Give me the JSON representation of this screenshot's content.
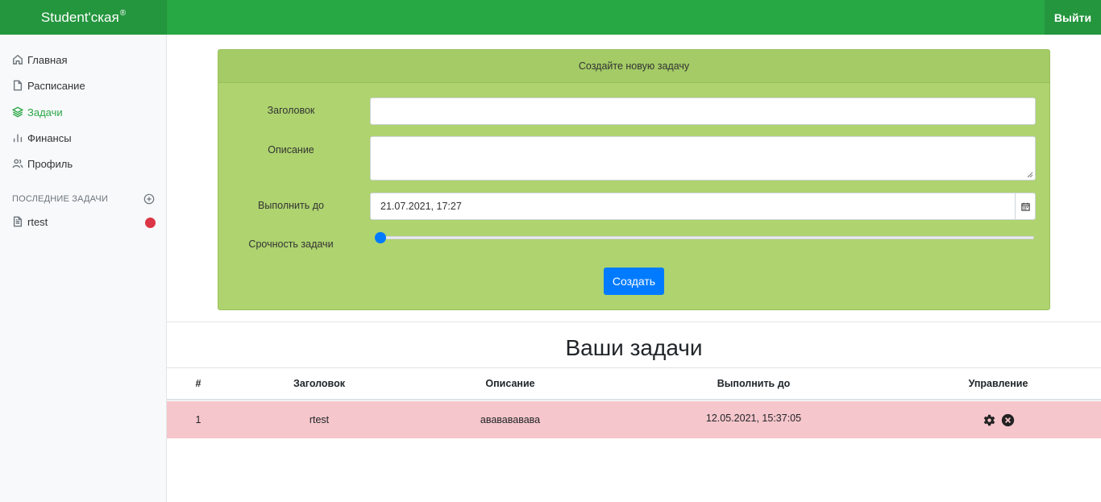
{
  "navbar": {
    "brand": "Student'ская",
    "brand_mark": "®",
    "logout_label": "Выйти",
    "color": "#28a745"
  },
  "sidebar": {
    "items": [
      {
        "label": "Главная",
        "icon": "home-icon",
        "active": false
      },
      {
        "label": "Расписание",
        "icon": "file-icon",
        "active": false
      },
      {
        "label": "Задачи",
        "icon": "layers-icon",
        "active": true
      },
      {
        "label": "Финансы",
        "icon": "bar-chart-icon",
        "active": false
      },
      {
        "label": "Профиль",
        "icon": "users-icon",
        "active": false
      }
    ],
    "recent_heading": "ПОСЛЕДНИЕ ЗАДАЧИ",
    "recent_tasks": [
      {
        "label": "rtest",
        "status_color": "#dc3545"
      }
    ]
  },
  "form": {
    "header": "Создайте новую задачу",
    "title_label": "Заголовок",
    "title_value": "",
    "description_label": "Описание",
    "description_value": "",
    "due_label": "Выполнить до",
    "due_value": "21.07.2021, 17:27",
    "urgency_label": "Срочность задачи",
    "urgency_value": 0,
    "submit_label": "Создать"
  },
  "tasks": {
    "title": "Ваши задачи",
    "columns": [
      "#",
      "Заголовок",
      "Описание",
      "Выполнить до",
      "Управление"
    ],
    "rows": [
      {
        "num": "1",
        "title": "rtest",
        "description": "ававававава",
        "due": "12.05.2021, 15:37:05"
      }
    ]
  }
}
